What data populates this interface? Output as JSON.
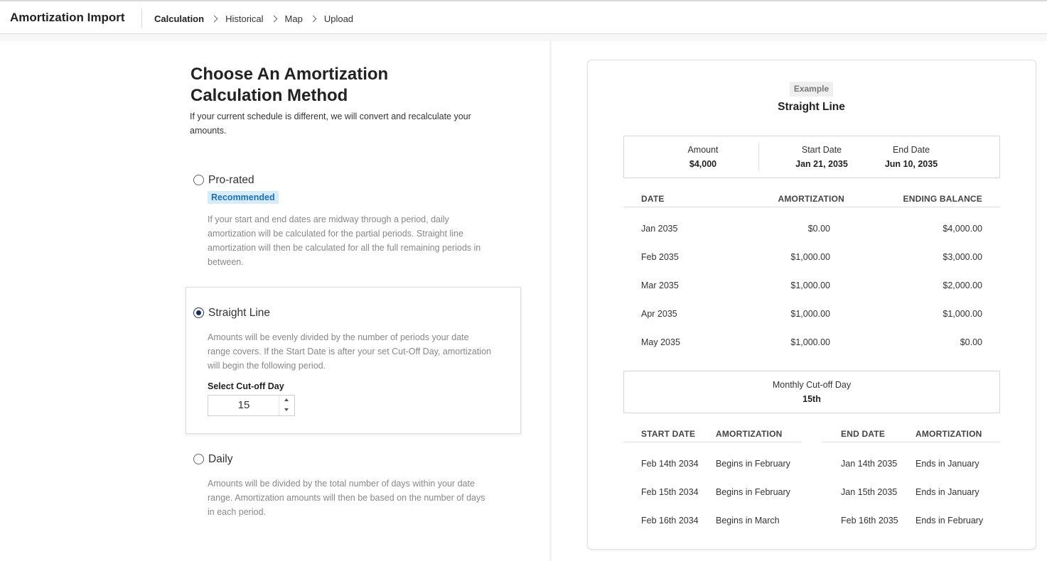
{
  "header": {
    "app_title": "Amortization Import",
    "breadcrumbs": [
      "Calculation",
      "Historical",
      "Map",
      "Upload"
    ]
  },
  "left": {
    "heading": "Choose An Amortization Calculation Method",
    "subheading": "If your current schedule is different, we will convert and recalculate your amounts.",
    "options": [
      {
        "label": "Pro-rated",
        "badge": "Recommended",
        "selected": false,
        "description": "If your start and end dates are midway through a period, daily amortization will be calculated for the partial periods. Straight line amortization will then be calculated for all the full remaining periods in between."
      },
      {
        "label": "Straight Line",
        "selected": true,
        "description": "Amounts will be evenly divided by the number of periods your date range covers. If the Start Date is after your set Cut-Off Day, amortization will begin the following period.",
        "cutoff_label": "Select Cut-off Day",
        "cutoff_value": "15"
      },
      {
        "label": "Daily",
        "selected": false,
        "description": "Amounts will be divided by the total number of days within your date range. Amortization amounts will then be based on the number of days in each period."
      }
    ]
  },
  "example": {
    "tag": "Example",
    "title": "Straight Line",
    "summary": {
      "amount_label": "Amount",
      "amount_value": "$4,000",
      "start_label": "Start Date",
      "start_value": "Jan 21, 2035",
      "end_label": "End Date",
      "end_value": "Jun 10, 2035"
    },
    "schedule_headers": [
      "DATE",
      "AMORTIZATION",
      "ENDING BALANCE"
    ],
    "schedule_rows": [
      {
        "date": "Jan 2035",
        "amortization": "$0.00",
        "balance": "$4,000.00"
      },
      {
        "date": "Feb 2035",
        "amortization": "$1,000.00",
        "balance": "$3,000.00"
      },
      {
        "date": "Mar 2035",
        "amortization": "$1,000.00",
        "balance": "$2,000.00"
      },
      {
        "date": "Apr 2035",
        "amortization": "$1,000.00",
        "balance": "$1,000.00"
      },
      {
        "date": "May 2035",
        "amortization": "$1,000.00",
        "balance": "$0.00"
      }
    ],
    "cutoff": {
      "label": "Monthly Cut-off Day",
      "value": "15th"
    },
    "start_headers": [
      "START DATE",
      "AMORTIZATION"
    ],
    "end_headers": [
      "END DATE",
      "AMORTIZATION"
    ],
    "cutoff_rows": [
      {
        "start_date": "Feb 14th 2034",
        "start_amort": "Begins in February",
        "end_date": "Jan 14th 2035",
        "end_amort": "Ends in January"
      },
      {
        "start_date": "Feb 15th 2034",
        "start_amort": "Begins in February",
        "end_date": "Jan 15th 2035",
        "end_amort": "Ends in January"
      },
      {
        "start_date": "Feb 16th 2034",
        "start_amort": "Begins in March",
        "end_date": "Feb 16th 2035",
        "end_amort": "Ends in February"
      }
    ]
  }
}
